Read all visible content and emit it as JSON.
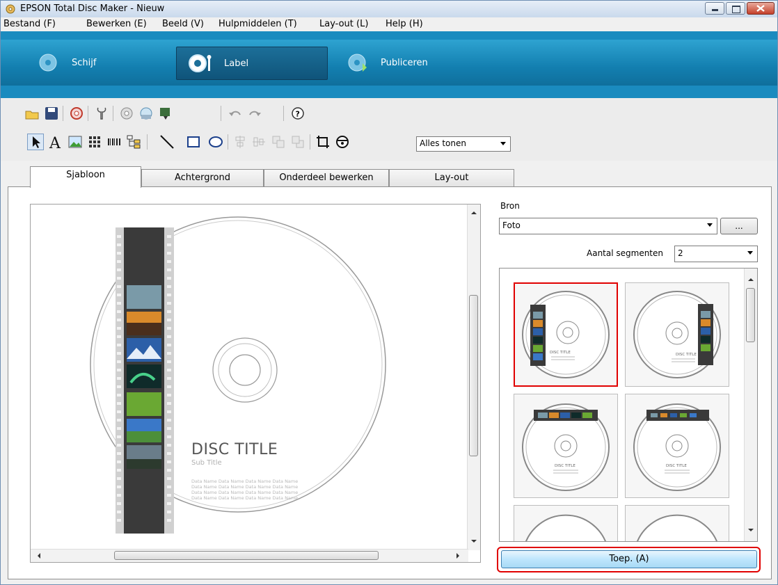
{
  "window": {
    "title": "EPSON Total Disc Maker - Nieuw"
  },
  "menu": [
    "Bestand (F)",
    "Bewerken (E)",
    "Beeld (V)",
    "Hulpmiddelen (T)",
    "Lay-out (L)",
    "Help (H)"
  ],
  "modes": [
    {
      "label": "Schijf",
      "active": false
    },
    {
      "label": "Label",
      "active": true
    },
    {
      "label": "Publiceren",
      "active": false
    }
  ],
  "toolbar": {
    "display_select": "Alles tonen"
  },
  "tabs": [
    {
      "label": "Sjabloon",
      "active": true
    },
    {
      "label": "Achtergrond",
      "active": false
    },
    {
      "label": "Onderdeel bewerken",
      "active": false
    },
    {
      "label": "Lay-out",
      "active": false
    }
  ],
  "disc": {
    "title": "DISC TITLE",
    "subtitle": "Sub Title",
    "data_lines": [
      "Data Name Data Name Data Name Data Name",
      "Data Name Data Name Data Name Data Name",
      "Data Name Data Name Data Name Data Name",
      "Data Name Data Name Data Name Data Name"
    ]
  },
  "source": {
    "label": "Bron",
    "value": "Foto",
    "browse_label": "..."
  },
  "segments": {
    "label": "Aantal segmenten",
    "value": "2"
  },
  "gallery": {
    "thumb_title": "DISC TITLE"
  },
  "apply_button": "Toep. (A)",
  "colors": {
    "ribbon": "#1a8bbf",
    "selection": "#e00000",
    "window_bg": "#f0f0f0"
  }
}
